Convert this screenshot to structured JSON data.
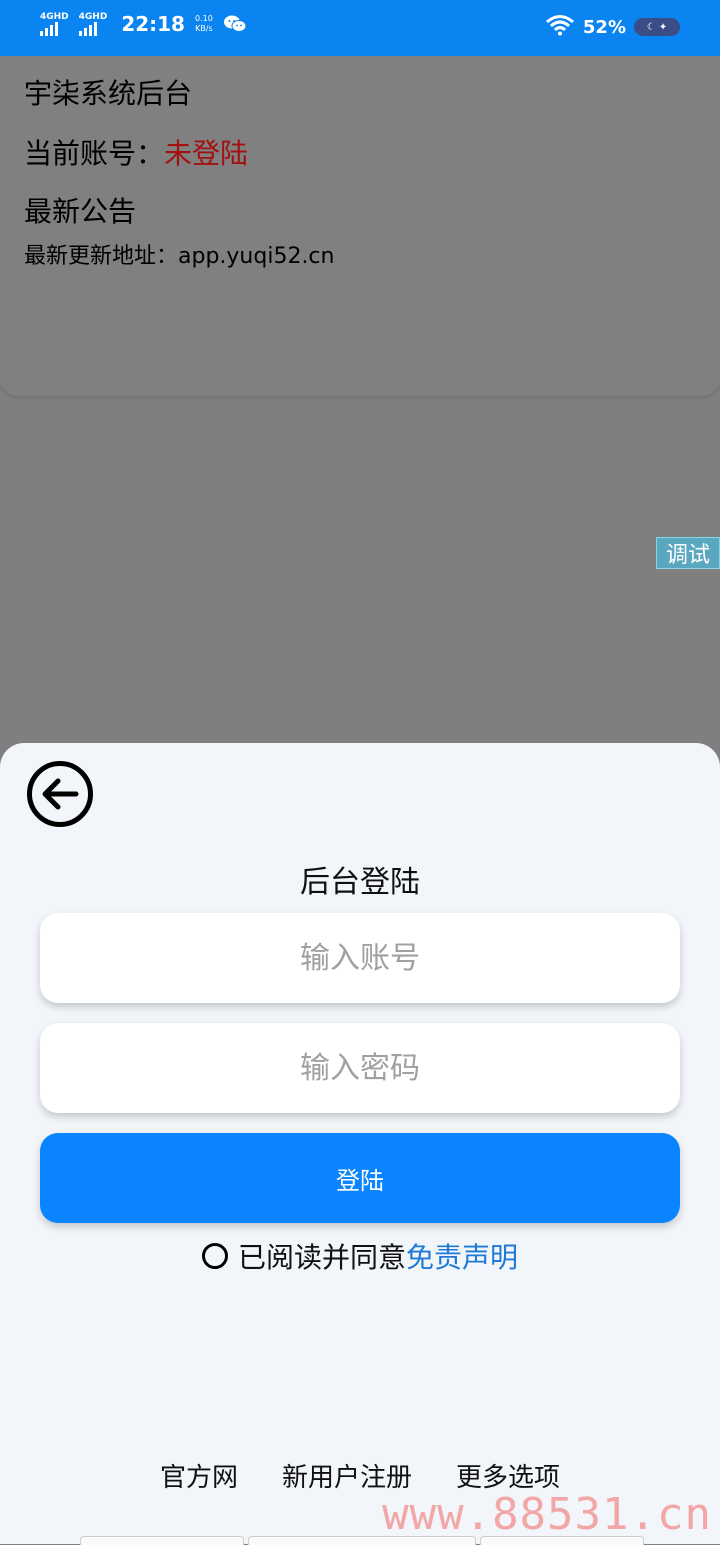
{
  "status_bar": {
    "sim1": "4GHD",
    "sim2": "4GHD",
    "time": "22:18",
    "speed_value": "0.10",
    "speed_unit": "KB/s",
    "battery": "52%"
  },
  "info_card": {
    "title": "宇柒系统后台",
    "account_label": "当前账号：",
    "account_status": "未登陆",
    "notice_title": "最新公告",
    "notice_text": "最新更新地址：app.yuqi52.cn"
  },
  "debug_label": "调试",
  "login_sheet": {
    "title": "后台登陆",
    "account_placeholder": "输入账号",
    "password_placeholder": "输入密码",
    "login_button": "登陆",
    "agree_text": "已阅读并同意",
    "disclaimer_link": "免责声明",
    "footer_links": [
      "官方网",
      "新用户注册",
      "更多选项"
    ]
  },
  "watermark": "www.88531.cn",
  "colors": {
    "status_bar": "#0a84f0",
    "primary_button": "#0a84ff",
    "link": "#1e7ad6",
    "account_status": "#a31010",
    "overlay": "#7f7f7f",
    "sheet_bg": "#f2f5f9"
  }
}
